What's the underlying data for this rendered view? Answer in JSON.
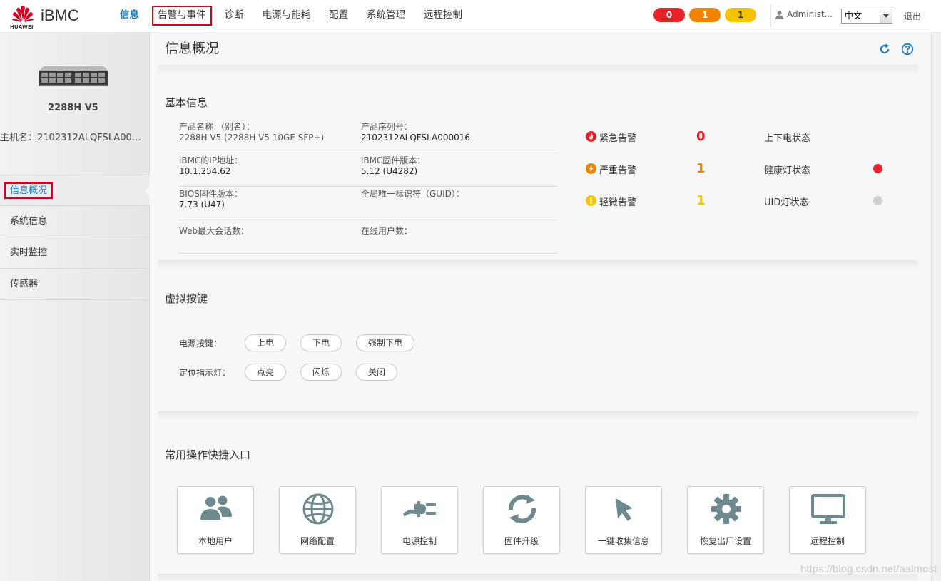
{
  "header": {
    "brand": "iBMC",
    "logo_text": "HUAWEI",
    "nav": [
      "信息",
      "告警与事件",
      "诊断",
      "电源与能耗",
      "配置",
      "系统管理",
      "远程控制"
    ],
    "alarm_counts": {
      "critical": "0",
      "major": "1",
      "minor": "1"
    },
    "user": "Administ...",
    "language": "中文",
    "logout": "退出"
  },
  "sidebar": {
    "model": "2288H V5",
    "hostname": "主机名：2102312ALQFSLA0000...",
    "items": [
      "信息概况",
      "系统信息",
      "实时监控",
      "传感器"
    ]
  },
  "page": {
    "title": "信息概况"
  },
  "basic": {
    "title": "基本信息",
    "product_name_label": "产品名称 （别名）：",
    "product_name_value": "2288H V5 (2288H V5 10GE SFP+)",
    "serial_label": "产品序列号：",
    "serial_value": "2102312ALQFSLA000016",
    "ip_label": "iBMC的IP地址：",
    "ip_value": "10.1.254.62",
    "fw_label": "iBMC固件版本：",
    "fw_value": "5.12 (U4282)",
    "bios_label": "BIOS固件版本：",
    "bios_value": "7.73 (U47)",
    "guid_label": "全局唯一标识符（GUID）：",
    "guid_value": "",
    "web_label": "Web最大会话数：",
    "online_label": "在线用户数："
  },
  "alarm_status": {
    "critical_label": "紧急告警",
    "critical_count": "0",
    "major_label": "严重告警",
    "major_count": "1",
    "minor_label": "轻微告警",
    "minor_count": "1",
    "power_label": "上下电状态",
    "health_label": "健康灯状态",
    "health_color": "#e8202a",
    "uid_label": "UID灯状态",
    "uid_color": "#d0d0d0"
  },
  "virtual_buttons": {
    "title": "虚拟按键",
    "power_label": "电源按键：",
    "power_on": "上电",
    "power_off": "下电",
    "force_off": "强制下电",
    "locate_label": "定位指示灯：",
    "light_on": "点亮",
    "blink": "闪烁",
    "light_off": "关闭"
  },
  "quick": {
    "title": "常用操作快捷入口",
    "items": [
      "本地用户",
      "网络配置",
      "电源控制",
      "固件升级",
      "一键收集信息",
      "恢复出厂设置",
      "远程控制"
    ]
  },
  "colors": {
    "accent": "#1a7cc1",
    "critical": "#e8202a",
    "major": "#f08300",
    "minor": "#f5c400",
    "icon_grey": "#6f8a8f"
  },
  "icons": {
    "refresh": "refresh-icon",
    "help": "help-icon"
  },
  "watermark": "https://blog.csdn.net/aalmost"
}
